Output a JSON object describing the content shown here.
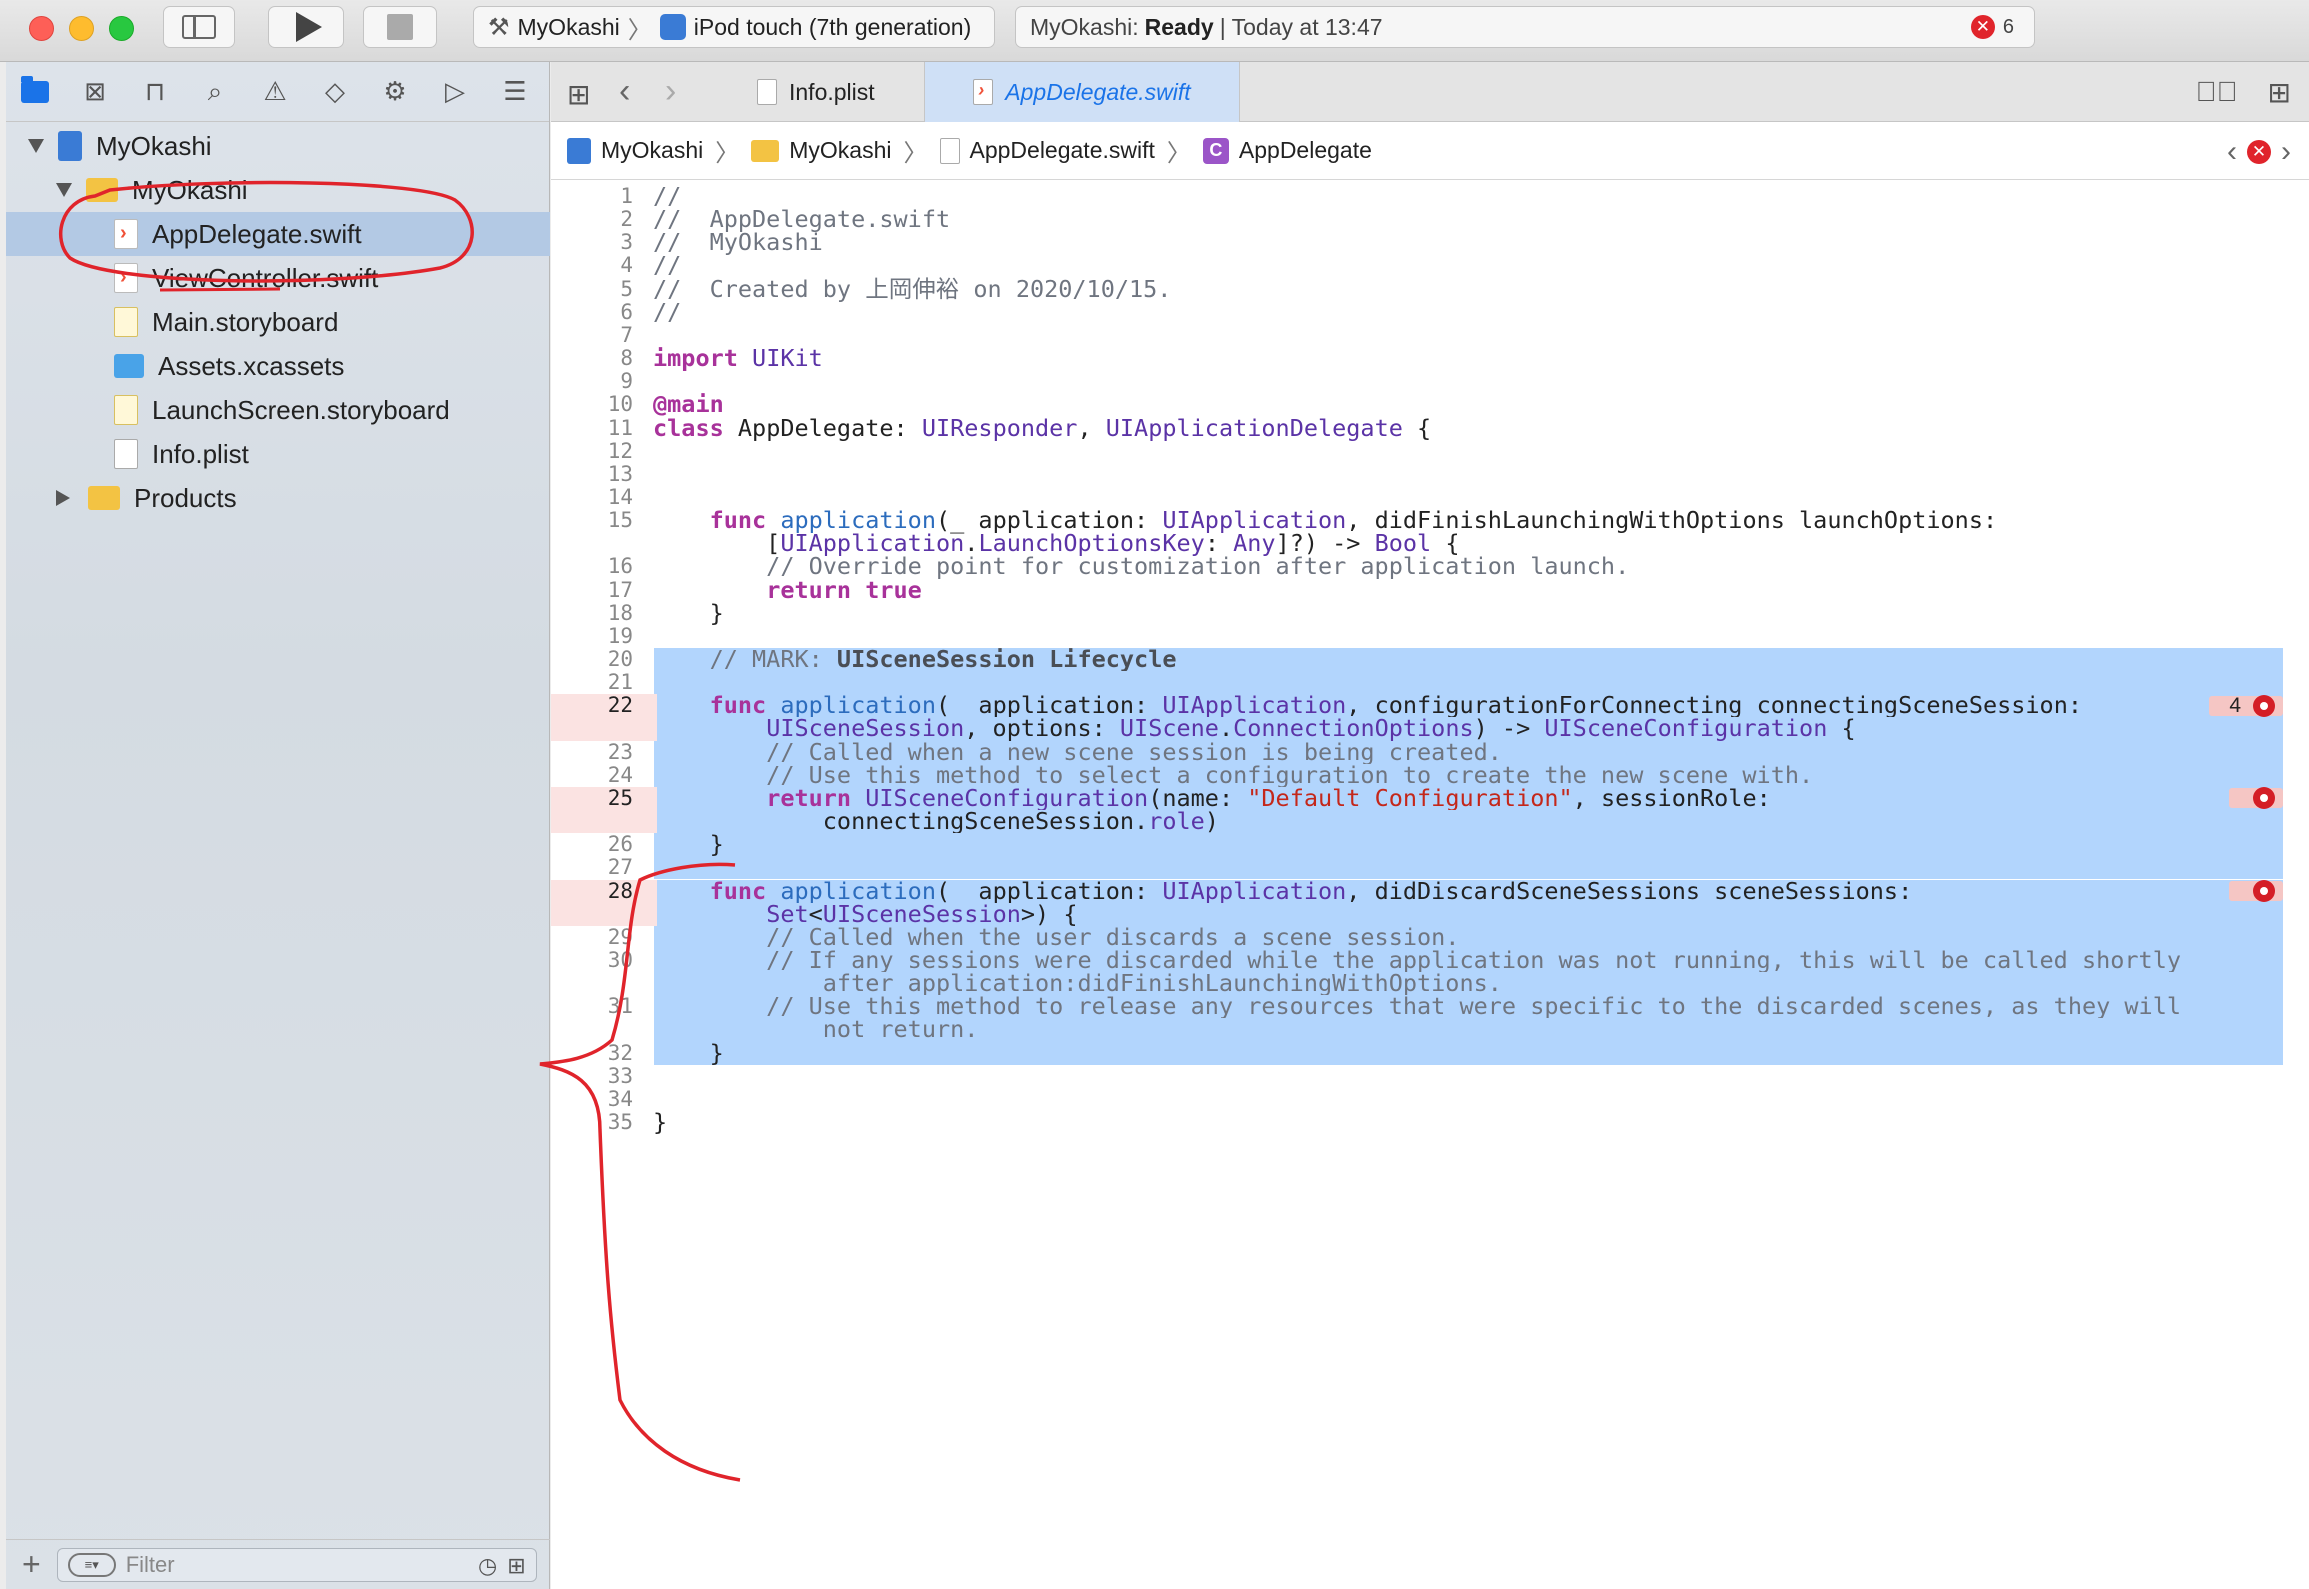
{
  "window": {
    "scheme": {
      "project": "MyOkashi",
      "device": "iPod touch (7th generation)"
    },
    "activity": {
      "project": "MyOkashi:",
      "status": "Ready",
      "time": "| Today at 13:47",
      "error_count": "6"
    }
  },
  "navigator": {
    "tree": [
      {
        "label": "MyOkashi",
        "kind": "project",
        "depth": 0,
        "disclosure": "open"
      },
      {
        "label": "MyOkashi",
        "kind": "folder",
        "depth": 1,
        "disclosure": "open"
      },
      {
        "label": "AppDelegate.swift",
        "kind": "swift",
        "depth": 2,
        "selected": true
      },
      {
        "label": "ViewController.swift",
        "kind": "swift",
        "depth": 2
      },
      {
        "label": "Main.storyboard",
        "kind": "storyboard",
        "depth": 2
      },
      {
        "label": "Assets.xcassets",
        "kind": "assets",
        "depth": 2
      },
      {
        "label": "LaunchScreen.storyboard",
        "kind": "storyboard",
        "depth": 2
      },
      {
        "label": "Info.plist",
        "kind": "plist",
        "depth": 2
      },
      {
        "label": "Products",
        "kind": "folder",
        "depth": 1,
        "disclosure": "closed"
      }
    ],
    "filter_placeholder": "Filter"
  },
  "editor": {
    "tabs": [
      {
        "label": "Info.plist",
        "active": false
      },
      {
        "label": "AppDelegate.swift",
        "active": true
      }
    ],
    "jump_bar": [
      "MyOkashi",
      "MyOkashi",
      "AppDelegate.swift",
      "AppDelegate"
    ],
    "issues": [
      {
        "line": "22",
        "count": "4"
      },
      {
        "line": "25",
        "count": ""
      },
      {
        "line": "28",
        "count": ""
      }
    ],
    "lines": [
      {
        "n": "1",
        "text": "//"
      },
      {
        "n": "2",
        "text": "//  AppDelegate.swift"
      },
      {
        "n": "3",
        "text": "//  MyOkashi"
      },
      {
        "n": "4",
        "text": "//"
      },
      {
        "n": "5",
        "text": "//  Created by 上岡伸裕 on 2020/10/15."
      },
      {
        "n": "6",
        "text": "//"
      },
      {
        "n": "7",
        "text": ""
      },
      {
        "n": "8",
        "text": "import UIKit"
      },
      {
        "n": "9",
        "text": ""
      },
      {
        "n": "10",
        "text": "@main"
      },
      {
        "n": "11",
        "text": "class AppDelegate: UIResponder, UIApplicationDelegate {"
      },
      {
        "n": "12",
        "text": ""
      },
      {
        "n": "13",
        "text": ""
      },
      {
        "n": "14",
        "text": ""
      },
      {
        "n": "15",
        "text": "    func application(_ application: UIApplication, didFinishLaunchingWithOptions launchOptions:"
      },
      {
        "n": "",
        "text": "        [UIApplication.LaunchOptionsKey: Any]?) -> Bool {"
      },
      {
        "n": "16",
        "text": "        // Override point for customization after application launch."
      },
      {
        "n": "17",
        "text": "        return true"
      },
      {
        "n": "18",
        "text": "    }"
      },
      {
        "n": "19",
        "text": ""
      },
      {
        "n": "20",
        "text": "    // MARK: UISceneSession Lifecycle"
      },
      {
        "n": "21",
        "text": ""
      },
      {
        "n": "22",
        "text": "    func application(_ application: UIApplication, configurationForConnecting connectingSceneSession:"
      },
      {
        "n": "",
        "text": "        UISceneSession, options: UIScene.ConnectionOptions) -> UISceneConfiguration {"
      },
      {
        "n": "23",
        "text": "        // Called when a new scene session is being created."
      },
      {
        "n": "24",
        "text": "        // Use this method to select a configuration to create the new scene with."
      },
      {
        "n": "25",
        "text": "        return UISceneConfiguration(name: \"Default Configuration\", sessionRole:"
      },
      {
        "n": "",
        "text": "            connectingSceneSession.role)"
      },
      {
        "n": "26",
        "text": "    }"
      },
      {
        "n": "27",
        "text": ""
      },
      {
        "n": "28",
        "text": "    func application(_ application: UIApplication, didDiscardSceneSessions sceneSessions:"
      },
      {
        "n": "",
        "text": "        Set<UISceneSession>) {"
      },
      {
        "n": "29",
        "text": "        // Called when the user discards a scene session."
      },
      {
        "n": "30",
        "text": "        // If any sessions were discarded while the application was not running, this will be called shortly"
      },
      {
        "n": "",
        "text": "            after application:didFinishLaunchingWithOptions."
      },
      {
        "n": "31",
        "text": "        // Use this method to release any resources that were specific to the discarded scenes, as they will"
      },
      {
        "n": "",
        "text": "            not return."
      },
      {
        "n": "32",
        "text": "    }"
      },
      {
        "n": "33",
        "text": ""
      },
      {
        "n": "34",
        "text": ""
      },
      {
        "n": "35",
        "text": "}"
      }
    ]
  },
  "colors": {
    "accent": "#1a73e8",
    "selection": "#b2d5fd",
    "error": "#d41e26",
    "annotation": "#e0242b"
  }
}
